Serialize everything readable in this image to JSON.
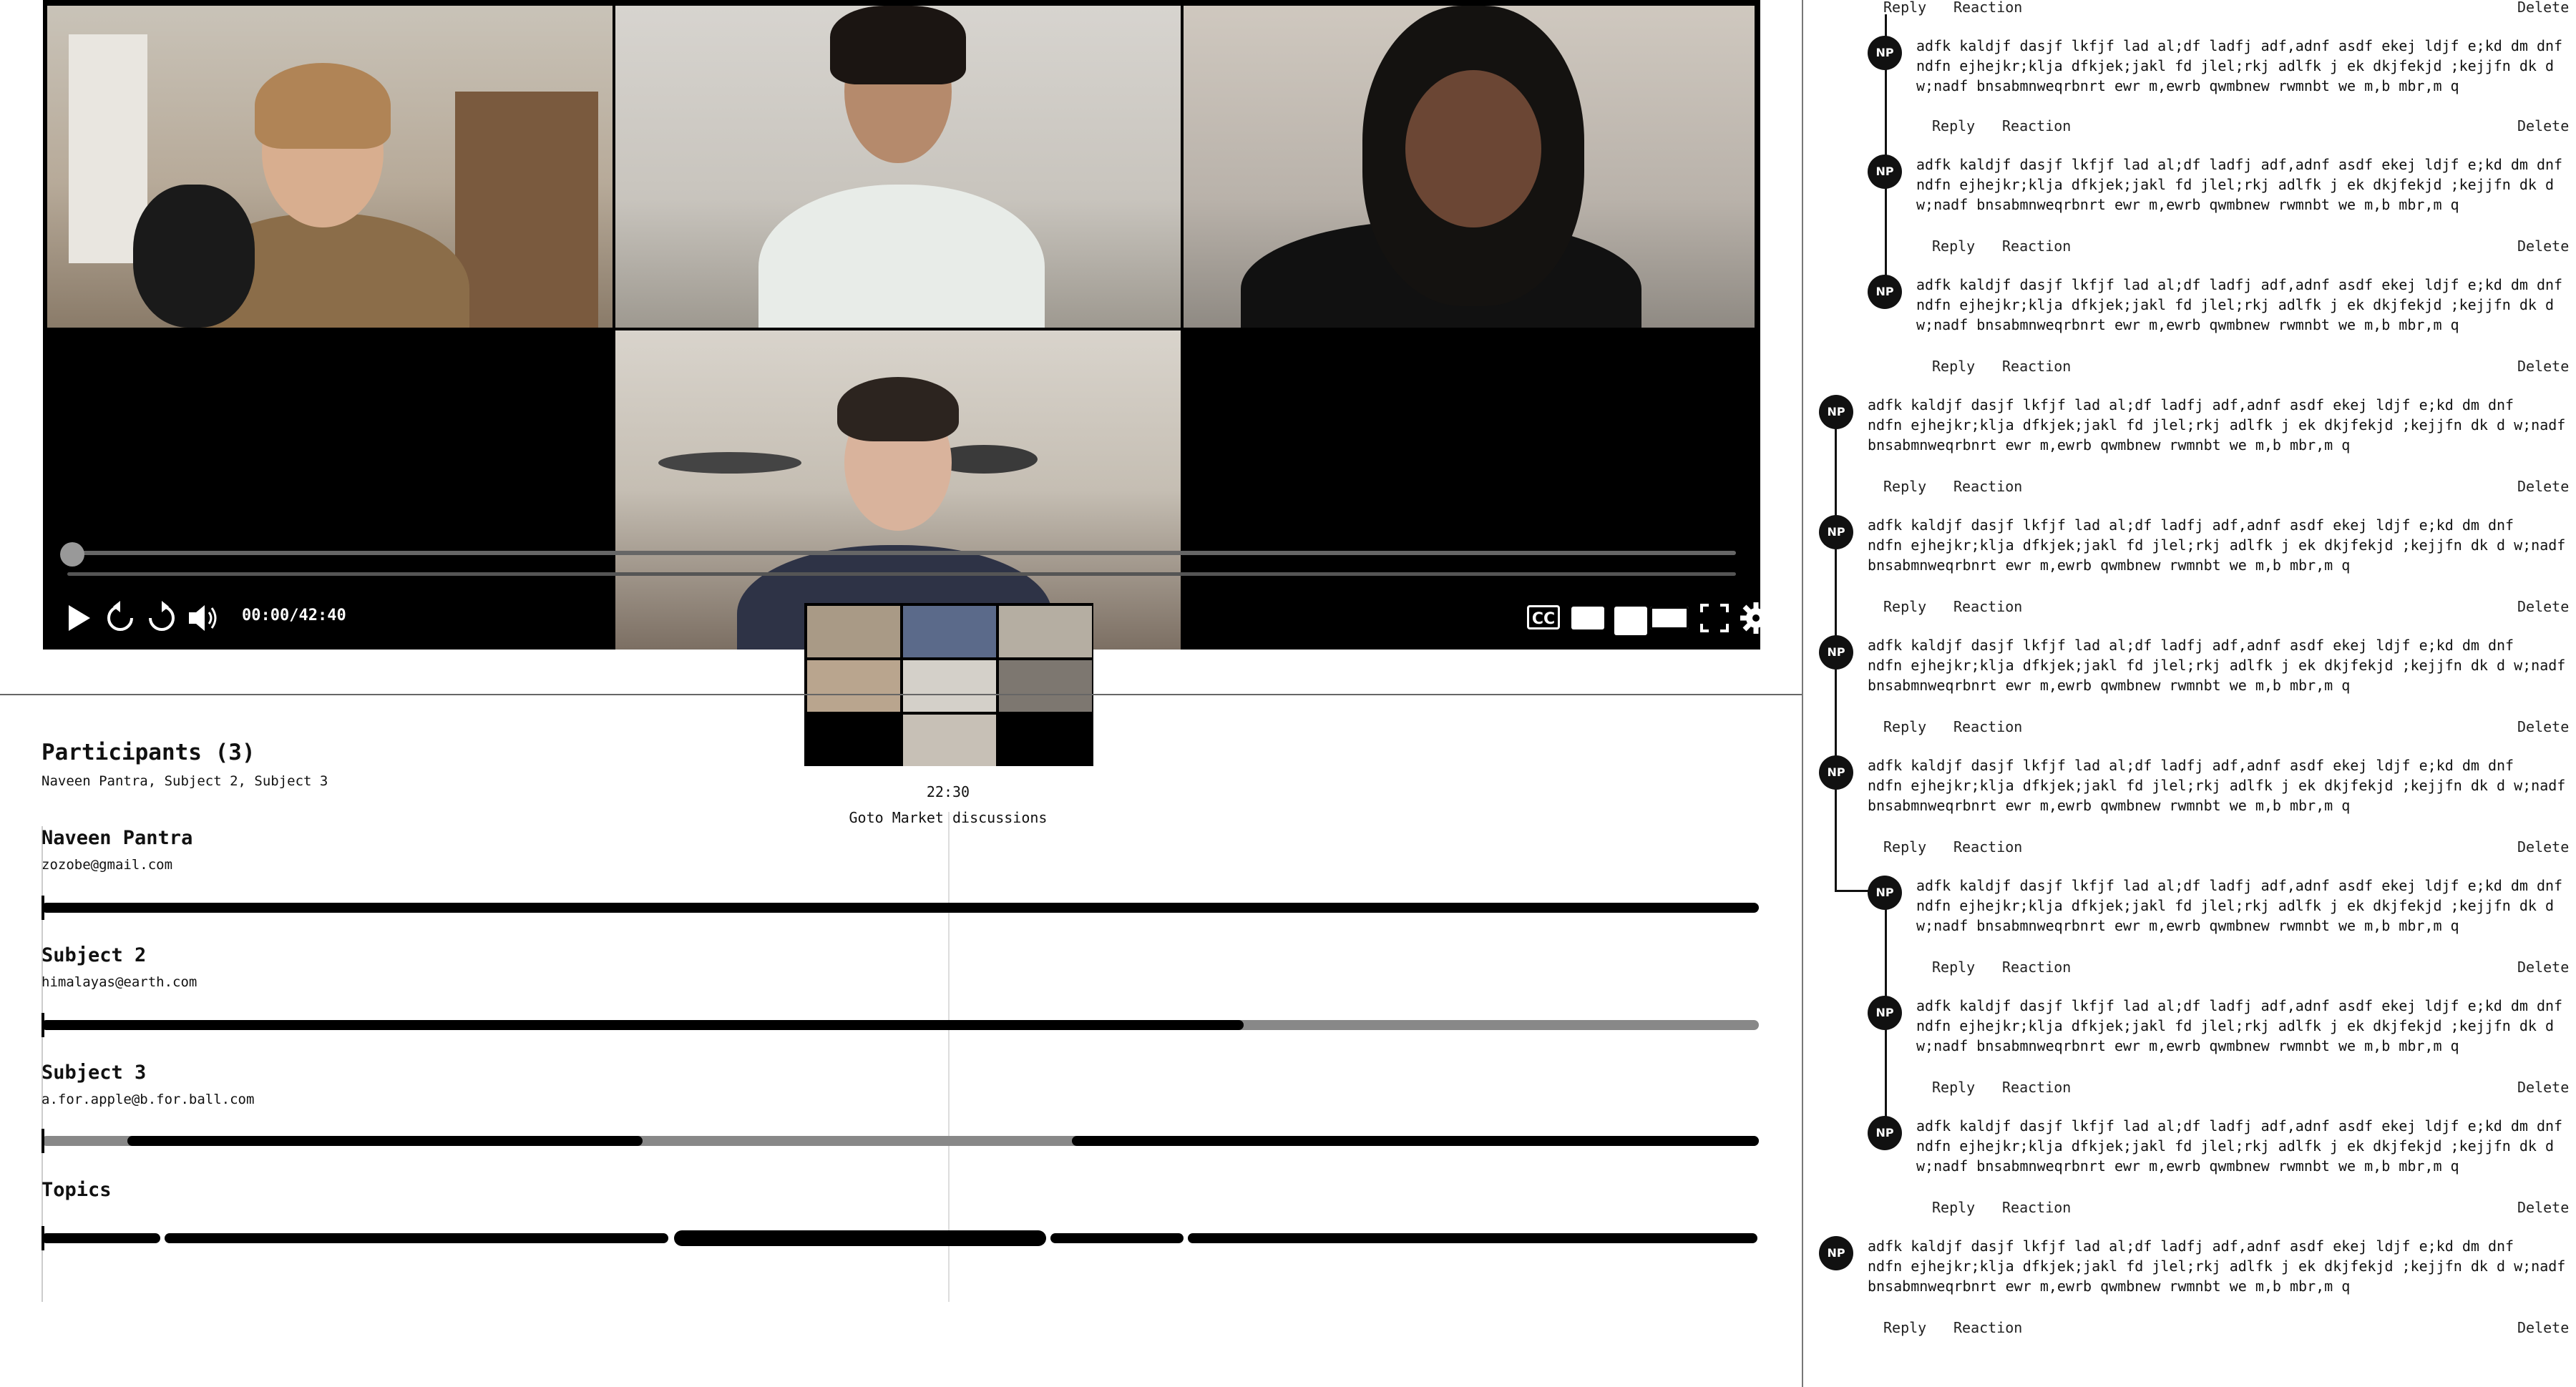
{
  "player": {
    "time": "00:00/42:40",
    "progress": 0,
    "controls": [
      "play-icon",
      "rewind-icon",
      "forward-icon",
      "volume-icon",
      "cc-icon",
      "screen-layout-1-icon",
      "screen-layout-2-icon",
      "screen-layout-3-icon",
      "fullscreen-icon",
      "gear-icon"
    ],
    "cc_label": "CC"
  },
  "marker": {
    "time": "22:30",
    "topic": "Goto Market discussions"
  },
  "participants": {
    "title": "Participants (3)",
    "subtitle": "Naveen Pantra, Subject 2, Subject 3",
    "people": [
      {
        "name": "Naveen Pantra",
        "email": "zozobe@gmail.com"
      },
      {
        "name": "Subject 2",
        "email": "himalayas@earth.com"
      },
      {
        "name": "Subject 3",
        "email": "a.for.apple@b.for.ball.com"
      }
    ],
    "topics_label": "Topics"
  },
  "comments": {
    "avatar": "NP",
    "text_lines": [
      "adfk kaldjf dasjf lkfjf lad al;df ladfj adf,adnf asdf ekej ldjf e;kd dm dnf",
      "ndfn ejhejkr;klja dfkjek;jakl fd jlel;rkj adlfk j ek dkjfekjd ;kejjfn dk d",
      "w;nadf bnsabmnweqrbnrt ewr m,ewrb qwmbnew rwmnbt we m,b mbr,m q"
    ],
    "text_lines_b": [
      "adfk kaldjf dasjf lkfjf lad al;df ladfj adf,adnf asdf ekej ldjf e;kd dm dnf",
      "ndfn ejhejkr;klja dfkjek;jakl fd jlel;rkj adlfk j ek dkjfekjd ;kejjfn dk d w;nadf",
      "bnsabmnweqrbnrt ewr m,ewrb qwmbnew rwmnbt we m,b mbr,m q"
    ],
    "reply": "Reply",
    "reaction": "Reaction",
    "delete": "Delete"
  }
}
